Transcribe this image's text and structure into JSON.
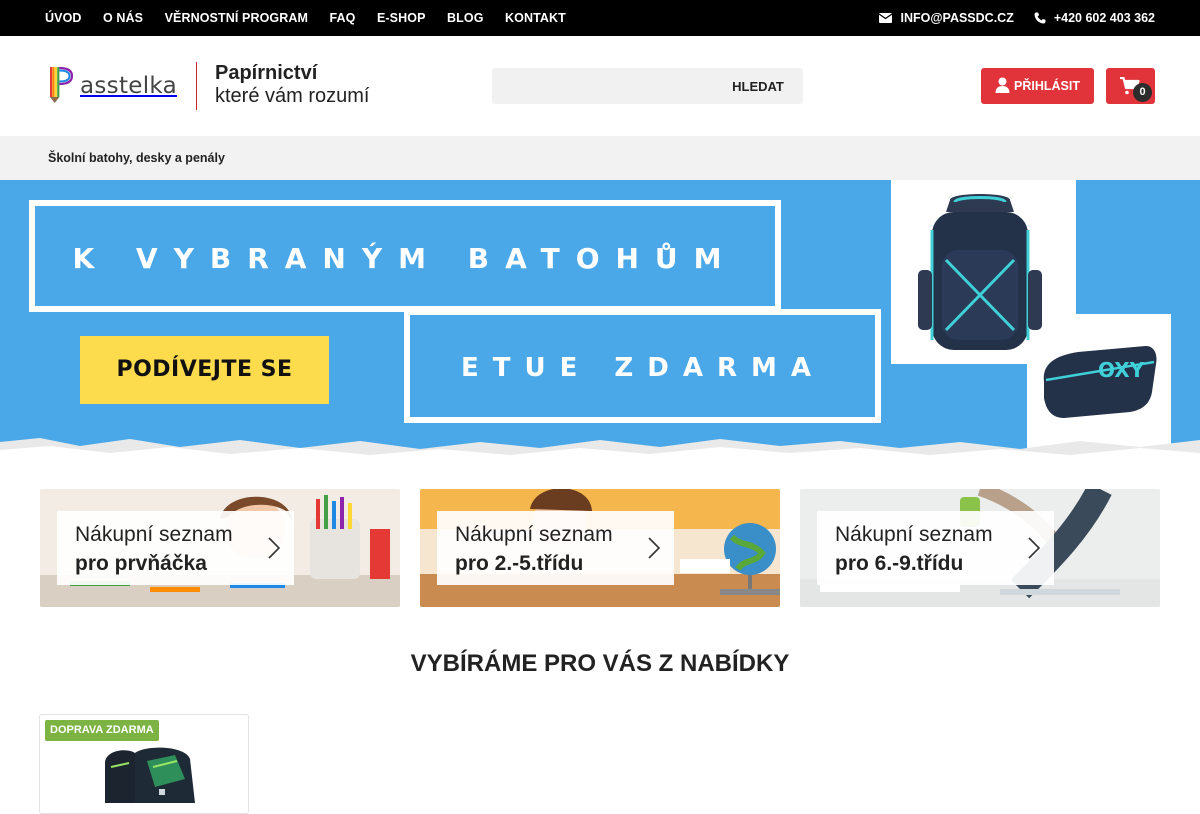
{
  "topbar": {
    "nav": [
      "ÚVOD",
      "O NÁS",
      "VĚRNOSTNÍ PROGRAM",
      "FAQ",
      "E-SHOP",
      "BLOG",
      "KONTAKT"
    ],
    "email": "INFO@PASSDC.CZ",
    "phone": "+420 602 403 362"
  },
  "header": {
    "logo_text": "asstelka",
    "tagline_1": "Papírnictví",
    "tagline_2": "které vám rozumí",
    "search_placeholder": "",
    "search_button": "HLEDAT",
    "login_label": "PŘIHLÁSIT",
    "cart_count": "0"
  },
  "catbar": {
    "link": "Školní batohy, desky a penály"
  },
  "banner": {
    "title": "K VYBRANÝM BATOHŮM",
    "cta": "PODÍVEJTE SE",
    "subtitle": "ETUE ZDARMA"
  },
  "cards": [
    {
      "line1": "Nákupní seznam",
      "line2": "pro prvňáčka"
    },
    {
      "line1": "Nákupní seznam",
      "line2": "pro 2.-5.třídu"
    },
    {
      "line1": "Nákupní seznam",
      "line2": "pro 6.-9.třídu"
    }
  ],
  "section_title": "VYBÍRÁME PRO VÁS Z NABÍDKY",
  "product": {
    "badge": "DOPRAVA ZDARMA"
  },
  "colors": {
    "accent": "#e0343a",
    "banner_blue": "#4aa8e8",
    "cta_yellow": "#fcdc4d",
    "badge_green": "#7cb342"
  }
}
